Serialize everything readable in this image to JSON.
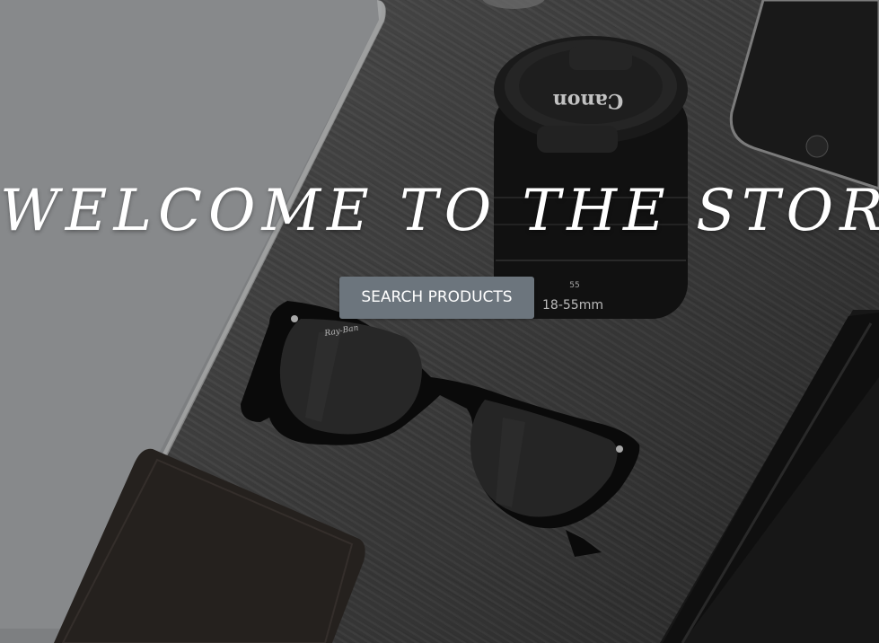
{
  "hero": {
    "title": "WELCOME TO THE STORE",
    "button_label": "SEARCH PRODUCTS",
    "lens_brand": "Canon",
    "lens_focal": "18-55mm",
    "sunglasses_brand": "Ray-Ban"
  },
  "colors": {
    "button_bg": "#6c757d",
    "title_color": "#ffffff",
    "desk": "#4a4a4a"
  }
}
